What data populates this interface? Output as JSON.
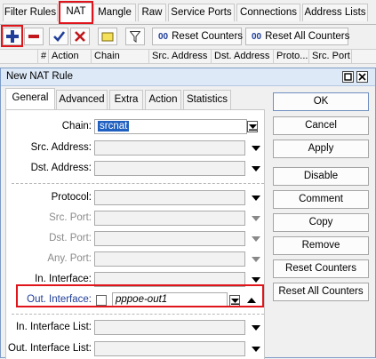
{
  "main_tabs": [
    {
      "label": "Filter Rules"
    },
    {
      "label": "NAT"
    },
    {
      "label": "Mangle"
    },
    {
      "label": "Raw"
    },
    {
      "label": "Service Ports"
    },
    {
      "label": "Connections"
    },
    {
      "label": "Address Lists"
    }
  ],
  "toolbar": {
    "reset_counters": "Reset Counters",
    "reset_all_counters": "Reset All Counters"
  },
  "columns": [
    {
      "label": "#"
    },
    {
      "label": "Action"
    },
    {
      "label": "Chain"
    },
    {
      "label": "Src. Address"
    },
    {
      "label": "Dst. Address"
    },
    {
      "label": "Proto..."
    },
    {
      "label": "Src. Port"
    }
  ],
  "dialog": {
    "title": "New NAT Rule",
    "tabs": [
      {
        "label": "General"
      },
      {
        "label": "Advanced"
      },
      {
        "label": "Extra"
      },
      {
        "label": "Action"
      },
      {
        "label": "Statistics"
      }
    ],
    "fields": {
      "chain": {
        "label": "Chain:",
        "value": "srcnat"
      },
      "src_address": {
        "label": "Src. Address:"
      },
      "dst_address": {
        "label": "Dst. Address:"
      },
      "protocol": {
        "label": "Protocol:"
      },
      "src_port": {
        "label": "Src. Port:"
      },
      "dst_port": {
        "label": "Dst. Port:"
      },
      "any_port": {
        "label": "Any. Port:"
      },
      "in_interface": {
        "label": "In. Interface:"
      },
      "out_interface": {
        "label": "Out. Interface:",
        "value": "pppoe-out1",
        "negate_checked": false
      },
      "in_interface_list": {
        "label": "In. Interface List:"
      },
      "out_interface_list": {
        "label": "Out. Interface List:"
      }
    },
    "buttons": {
      "ok": "OK",
      "cancel": "Cancel",
      "apply": "Apply",
      "disable": "Disable",
      "comment": "Comment",
      "copy": "Copy",
      "remove": "Remove",
      "reset_counters": "Reset Counters",
      "reset_all_counters": "Reset All Counters"
    }
  },
  "colors": {
    "highlight": "#e0141b",
    "add_icon": "#1f3d99",
    "remove_icon": "#c0161c",
    "check_icon": "#1f3d99",
    "x_icon": "#c0161c",
    "selection": "#1f5fbf"
  }
}
